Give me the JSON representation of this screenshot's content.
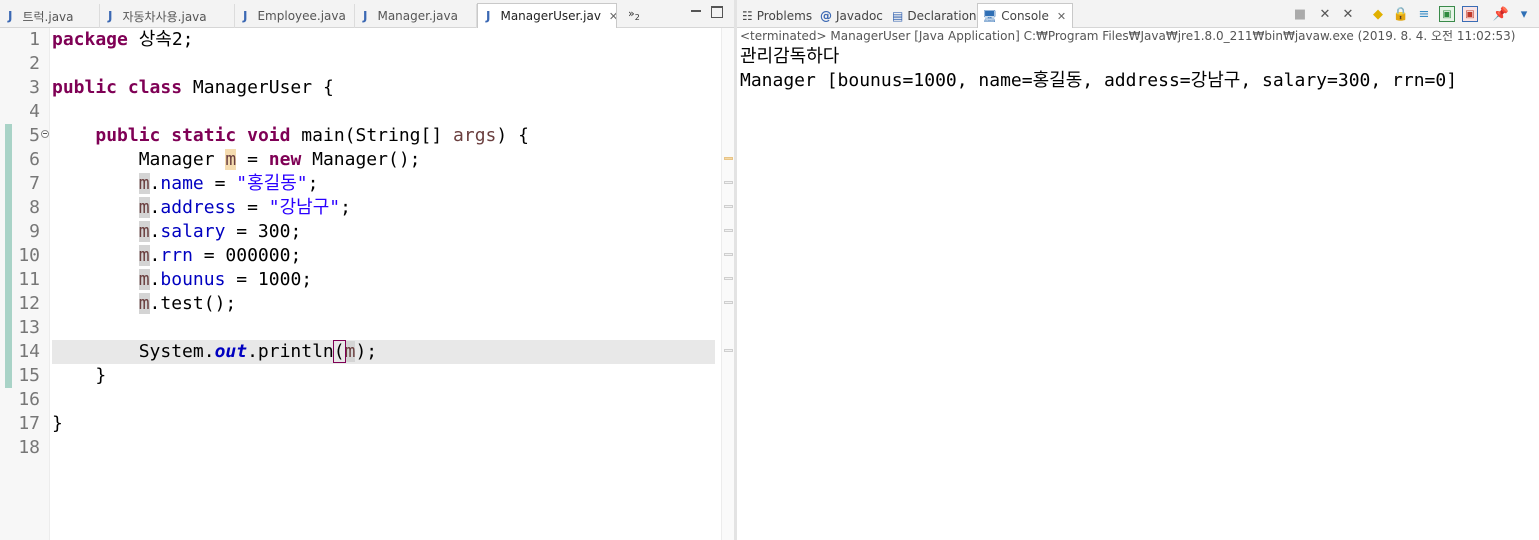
{
  "editor": {
    "tabs": [
      {
        "label": "트럭.java",
        "active": false
      },
      {
        "label": "자동차사용.java",
        "active": false
      },
      {
        "label": "Employee.java",
        "active": false
      },
      {
        "label": "Manager.java",
        "active": false
      },
      {
        "label": "ManagerUser.jav",
        "active": true
      }
    ],
    "overflow_label": "»",
    "overflow_count": "2",
    "line_numbers": [
      "1",
      "2",
      "3",
      "4",
      "5",
      "6",
      "7",
      "8",
      "9",
      "10",
      "11",
      "12",
      "13",
      "14",
      "15",
      "16",
      "17",
      "18"
    ],
    "code": {
      "l1_kw": "package",
      "l1_rest": " 상속2;",
      "l3_kw1": "public",
      "l3_kw2": "class",
      "l3_rest": " ManagerUser {",
      "l5_kw1": "public",
      "l5_kw2": "static",
      "l5_kw3": "void",
      "l5_mid": " main(String[] ",
      "l5_param": "args",
      "l5_end": ") {",
      "l6_a": "Manager ",
      "l6_var": "m",
      "l6_b": " = ",
      "l6_kw": "new",
      "l6_c": " Manager();",
      "l7_var": "m",
      "l7_dot": ".",
      "l7_fld": "name",
      "l7_eq": " = ",
      "l7_str": "\"홍길동\"",
      "l7_end": ";",
      "l8_var": "m",
      "l8_dot": ".",
      "l8_fld": "address",
      "l8_eq": " = ",
      "l8_str": "\"강남구\"",
      "l8_end": ";",
      "l9_var": "m",
      "l9_dot": ".",
      "l9_fld": "salary",
      "l9_rest": " = 300;",
      "l10_var": "m",
      "l10_dot": ".",
      "l10_fld": "rrn",
      "l10_rest": " = 000000;",
      "l11_var": "m",
      "l11_dot": ".",
      "l11_fld": "bounus",
      "l11_rest": " = 1000;",
      "l12_var": "m",
      "l12_rest": ".test();",
      "l14_a": "System.",
      "l14_stat": "out",
      "l14_b": ".println",
      "l14_open": "(",
      "l14_var": "m",
      "l14_end": ");",
      "l15": "}",
      "l17": "}"
    }
  },
  "console": {
    "tabs": {
      "problems": "Problems",
      "javadoc": "Javadoc",
      "declaration": "Declaration",
      "console": "Console"
    },
    "status": "<terminated> ManagerUser [Java Application] C:₩Program Files₩Java₩jre1.8.0_211₩bin₩javaw.exe (2019. 8. 4. 오전 11:02:53)",
    "output": [
      "관리감독하다",
      "Manager [bounus=1000, name=홍길동, address=강남구, salary=300, rrn=0]"
    ]
  },
  "icons": {
    "java_file": "java-file-icon",
    "problems": "problems-icon",
    "javadoc": "javadoc-icon",
    "declaration": "declaration-icon",
    "console": "console-icon"
  },
  "colors": {
    "keyword": "#7f0055",
    "string": "#2a00ff",
    "field": "#0000c0",
    "local_var": "#6a3e3e",
    "change_bar": "#a9d3c7",
    "current_line": "#e8e8e8"
  }
}
